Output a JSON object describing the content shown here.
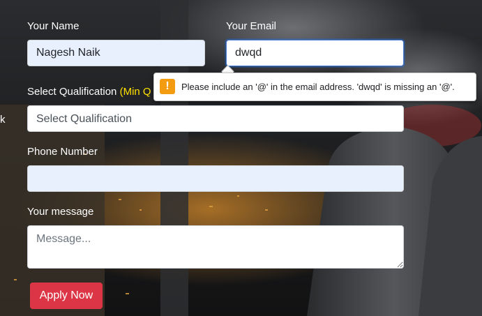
{
  "form": {
    "name_label": "Your Name",
    "name_value": "Nagesh Naik",
    "email_label": "Your Email",
    "email_value": "dwqd",
    "qualification_label": "Select Qualification",
    "qualification_hint": "(Min Q",
    "qualification_selected": "Select Qualification",
    "phone_label": "Phone Number",
    "phone_value": "",
    "message_label": "Your message",
    "message_placeholder": "Message...",
    "submit_label": "Apply Now",
    "left_edge_text": "k"
  },
  "validation_tooltip": {
    "icon": "warning-icon",
    "icon_glyph": "!",
    "message": "Please include an '@' in the email address. 'dwqd' is missing an '@'."
  },
  "colors": {
    "button": "#dc3545",
    "highlight_text": "#ffe100",
    "autofill_background": "#e8f0fe",
    "warning_icon": "#f39c12"
  }
}
